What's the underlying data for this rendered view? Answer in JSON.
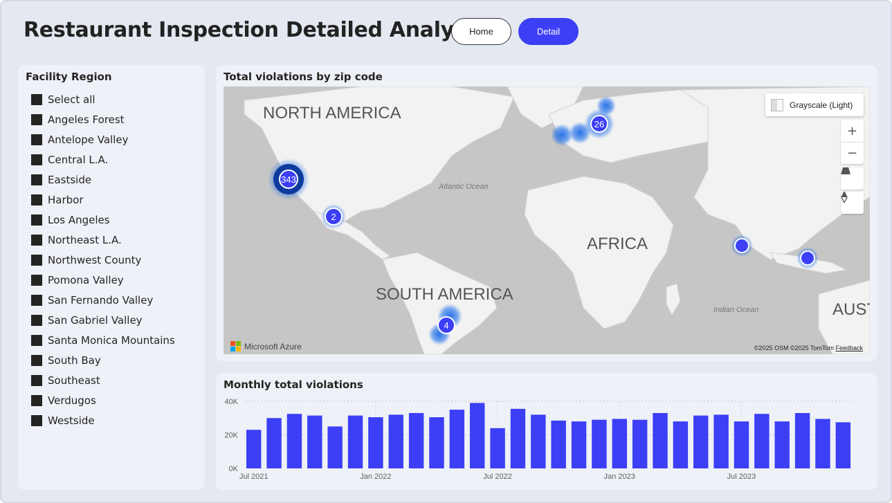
{
  "header": {
    "title": "Restaurant Inspection Detailed Analysis",
    "home_label": "Home",
    "detail_label": "Detail"
  },
  "slicer": {
    "title": "Facility Region",
    "items": [
      "Select all",
      "Angeles Forest",
      "Antelope Valley",
      "Central L.A.",
      "Eastside",
      "Harbor",
      "Los Angeles",
      "Northeast L.A.",
      "Northwest County",
      "Pomona Valley",
      "San Fernando Valley",
      "San Gabriel Valley",
      "Santa Monica Mountains",
      "South Bay",
      "Southeast",
      "Verdugos",
      "Westside"
    ]
  },
  "map": {
    "title": "Total violations by zip code",
    "style_label": "Grayscale (Light)",
    "labels": {
      "north_america": "NORTH AMERICA",
      "south_america": "SOUTH AMERICA",
      "africa": "AFRICA",
      "australia": "AUST",
      "atlantic": "Atlantic Ocean",
      "indian": "Indian Ocean"
    },
    "clusters": [
      {
        "label": "343",
        "region": "Los Angeles"
      },
      {
        "label": "26",
        "region": "Europe"
      },
      {
        "label": "2",
        "region": "Mexico"
      },
      {
        "label": "4",
        "region": "South America"
      }
    ],
    "brand": "Microsoft Azure",
    "attribution": "©2025 OSM  ©2025 TomTom",
    "feedback": "Feedback",
    "accent": "#3c3ff5",
    "glow": "#1e6ee8"
  },
  "chart_data": {
    "type": "bar",
    "title": "Monthly total violations",
    "xlabel": "",
    "ylabel": "",
    "ylim": [
      0,
      40000
    ],
    "yticks": [
      "0K",
      "20K",
      "40K"
    ],
    "xtick_labels": [
      "Jul 2021",
      "Jan 2022",
      "Jul 2022",
      "Jan 2023",
      "Jul 2023"
    ],
    "color": "#3c3ff5",
    "grid": true,
    "categories": [
      "2021-07",
      "2021-08",
      "2021-09",
      "2021-10",
      "2021-11",
      "2021-12",
      "2022-01",
      "2022-02",
      "2022-03",
      "2022-04",
      "2022-05",
      "2022-06",
      "2022-07",
      "2022-08",
      "2022-09",
      "2022-10",
      "2022-11",
      "2022-12",
      "2023-01",
      "2023-02",
      "2023-03",
      "2023-04",
      "2023-05",
      "2023-06",
      "2023-07",
      "2023-08",
      "2023-09",
      "2023-10",
      "2023-11",
      "2023-12"
    ],
    "values": [
      23000,
      30000,
      32500,
      31500,
      25000,
      31500,
      30500,
      32000,
      33000,
      30500,
      35000,
      39000,
      24000,
      35500,
      32000,
      28500,
      28000,
      29000,
      29500,
      29000,
      33000,
      28000,
      31500,
      32000,
      28000,
      32500,
      28000,
      33000,
      29500,
      27500
    ]
  }
}
